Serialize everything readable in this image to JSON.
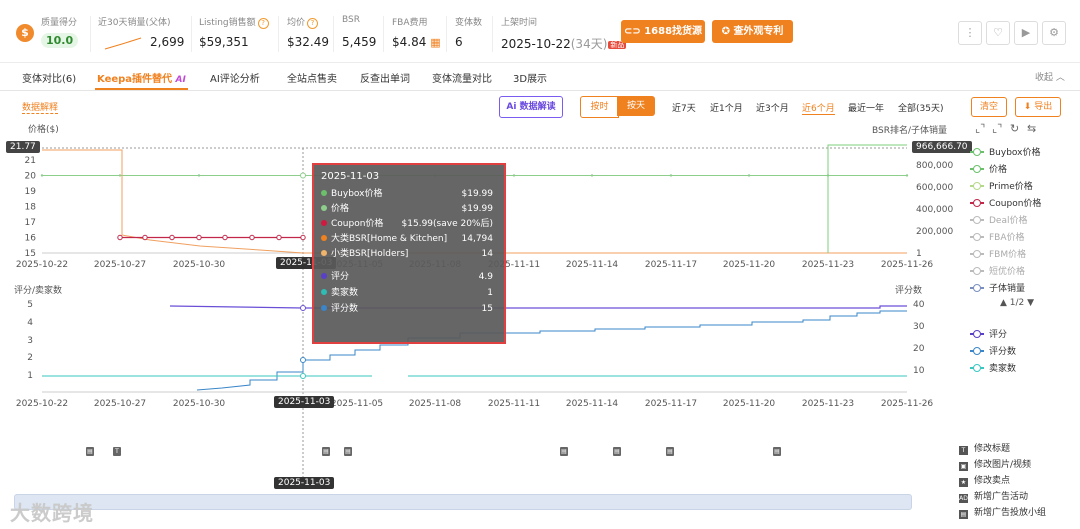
{
  "metrics": {
    "score": {
      "label": "质量得分",
      "value": "10.0"
    },
    "sales30": {
      "label": "近30天销量(父体)",
      "value": "2,699"
    },
    "revenue": {
      "label": "Listing销售额",
      "value": "$59,351"
    },
    "avg_price": {
      "label": "均价",
      "value": "$32.49"
    },
    "bsr": {
      "label": "BSR",
      "value": "5,459"
    },
    "fba": {
      "label": "FBA费用",
      "value": "$4.84"
    },
    "variants": {
      "label": "变体数",
      "value": "6"
    },
    "listed": {
      "label": "上架时间",
      "value": "2025-10-22",
      "age": "(34天)",
      "badge": "新品"
    },
    "btn_1688": "1688找货源",
    "btn_patent": "查外观专利"
  },
  "tabs": [
    "变体对比(6)",
    "Keepa插件替代",
    "AI评论分析",
    "全站点售卖",
    "反查出单词",
    "变体流量对比",
    "3D展示"
  ],
  "tab_ai_mark": "AI",
  "collapse": "收起 ︿",
  "toolbar": {
    "data_explain": "数据解释",
    "ai_interpret": "Ai 数据解读",
    "by_hour": "按时",
    "by_day": "按天",
    "ranges": [
      "近7天",
      "近1个月",
      "近3个月",
      "近6个月",
      "最近一年",
      "全部(35天)"
    ],
    "selected_range": "近6个月",
    "clear": "清空",
    "export": "⬇ 导出"
  },
  "chart_data": [
    {
      "type": "line",
      "title": "",
      "ylabel": "价格($)",
      "y2label": "BSR排名/子体销量",
      "x": [
        "2025-10-22",
        "2025-10-27",
        "2025-10-30",
        "2025-11-03",
        "2025-11-05",
        "2025-11-08",
        "2025-11-11",
        "2025-11-14",
        "2025-11-17",
        "2025-11-20",
        "2025-11-23",
        "2025-11-26"
      ],
      "yticks": [
        "15",
        "16",
        "17",
        "18",
        "19",
        "20",
        "21"
      ],
      "y2ticks": [
        "1",
        "200,000",
        "400,000",
        "600,000",
        "800,000"
      ],
      "ylim": [
        15,
        21.77
      ],
      "crosshair_y": "21.77",
      "crosshair_y2": "966,666.70",
      "series": [
        {
          "name": "价格",
          "color": "#8dce8d",
          "values": [
            20,
            20,
            20,
            20,
            20,
            20,
            20,
            20,
            20,
            20,
            20,
            20
          ]
        },
        {
          "name": "Coupon价格",
          "color": "#c2274a",
          "values": [
            null,
            16,
            16,
            16,
            null,
            null,
            null,
            null,
            null,
            null,
            null,
            null
          ]
        },
        {
          "name": "子体销量",
          "color": "#7ecf7e",
          "values": [
            1,
            1,
            1,
            1,
            1,
            1,
            1,
            1,
            1,
            1,
            966666,
            966666
          ]
        }
      ]
    },
    {
      "type": "line",
      "ylabel": "评分/卖家数",
      "y2label": "评分数",
      "x": [
        "2025-10-22",
        "2025-10-27",
        "2025-10-30",
        "2025-11-03",
        "2025-11-05",
        "2025-11-08",
        "2025-11-11",
        "2025-11-14",
        "2025-11-17",
        "2025-11-20",
        "2025-11-23",
        "2025-11-26"
      ],
      "yticks": [
        "1",
        "2",
        "3",
        "4",
        "5"
      ],
      "y2ticks": [
        "10",
        "20",
        "30",
        "40"
      ],
      "series": [
        {
          "name": "评分",
          "color": "#6a4fd6",
          "values": [
            null,
            4.9,
            4.9,
            4.9,
            4.9,
            4.9,
            4.9,
            4.9,
            4.9,
            4.9,
            4.9,
            5.0
          ]
        },
        {
          "name": "评分数",
          "color": "#3a86c8",
          "values": [
            null,
            0,
            2,
            5,
            10,
            15,
            19,
            21,
            23,
            26,
            29,
            35
          ]
        },
        {
          "name": "卖家数",
          "color": "#3ac7c0",
          "values": [
            1,
            1,
            1,
            1,
            1,
            null,
            1,
            1,
            1,
            1,
            1,
            1
          ]
        }
      ]
    }
  ],
  "legend_top": [
    {
      "name": "Buybox价格",
      "color": "#6cc06c",
      "dim": false
    },
    {
      "name": "价格",
      "color": "#6cc06c",
      "dim": false
    },
    {
      "name": "Prime价格",
      "color": "#b5d98a",
      "dim": false
    },
    {
      "name": "Coupon价格",
      "color": "#c2274a",
      "dim": false
    },
    {
      "name": "Deal价格",
      "color": "#bbbbbb",
      "dim": true
    },
    {
      "name": "FBA价格",
      "color": "#bbbbbb",
      "dim": true
    },
    {
      "name": "FBM价格",
      "color": "#bbbbbb",
      "dim": true
    },
    {
      "name": "短优价格",
      "color": "#bbbbbb",
      "dim": true
    },
    {
      "name": "子体销量",
      "color": "#7a8fbf",
      "dim": false
    }
  ],
  "legend_pager": "▲ 1/2 ▼",
  "legend_bottom": [
    {
      "name": "评分",
      "color": "#5a3fc8"
    },
    {
      "name": "评分数",
      "color": "#3a86c8"
    },
    {
      "name": "卖家数",
      "color": "#3ac7c0"
    }
  ],
  "tooltip": {
    "date": "2025-11-03",
    "rows": [
      {
        "name": "Buybox价格",
        "value": "$19.99",
        "color": "#6cc06c"
      },
      {
        "name": "价格",
        "value": "$19.99",
        "color": "#8dce8d"
      },
      {
        "name": "Coupon价格",
        "value": "$15.99(save 20%后)",
        "color": "#d01840"
      },
      {
        "name": "大类BSR[Home & Kitchen]",
        "value": "14,794",
        "color": "#f0811f"
      },
      {
        "name": "小类BSR[Holders]",
        "value": "14",
        "color": "#f0b46a"
      },
      {
        "name": "评分",
        "value": "4.9",
        "color": "#5a3fc8"
      },
      {
        "name": "卖家数",
        "value": "1",
        "color": "#2dbdb5"
      },
      {
        "name": "评分数",
        "value": "15",
        "color": "#3a86c8"
      }
    ]
  },
  "hover_date": "2025-11-03",
  "events_legend": [
    {
      "icon": "T",
      "name": "修改标题"
    },
    {
      "icon": "▣",
      "name": "修改图片/视频"
    },
    {
      "icon": "★",
      "name": "修改卖点"
    },
    {
      "icon": "AD",
      "name": "新增广告活动"
    },
    {
      "icon": "▤",
      "name": "新增广告投放小组"
    }
  ],
  "watermark": "大数跨境"
}
